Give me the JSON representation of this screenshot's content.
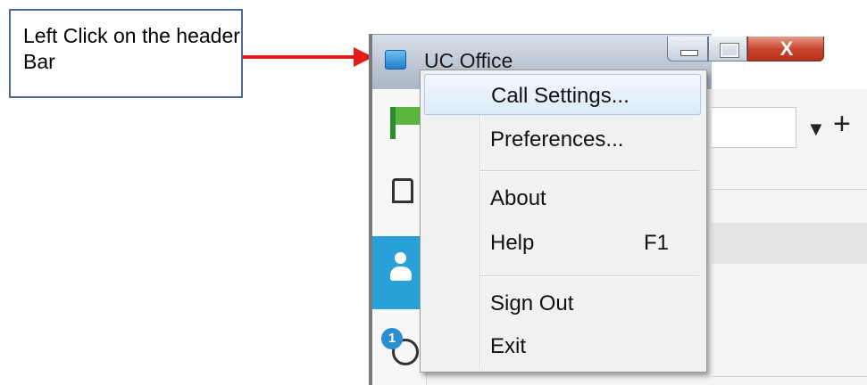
{
  "annotation": {
    "callout_text": "Left Click on the header Bar",
    "arrow_color": "#e21b1b",
    "border_color": "#4a6b96"
  },
  "window": {
    "title": "UC Office",
    "app_icon": "uc-office-app-icon",
    "caption_buttons": [
      "minimize",
      "maximize",
      "close"
    ],
    "close_glyph": "X"
  },
  "sidebar": {
    "items": [
      {
        "icon": "flag-icon"
      },
      {
        "icon": "building-icon"
      },
      {
        "icon": "person-icon",
        "selected": true
      },
      {
        "icon": "history-icon",
        "badge": "1"
      }
    ],
    "accent_color": "#2aa0d8"
  },
  "toolbar": {
    "filter_icon": "filter-icon",
    "add_glyph": "+"
  },
  "context_menu": {
    "items": [
      {
        "label": "Call Settings...",
        "shortcut": "",
        "highlighted": true
      },
      {
        "label": "Preferences...",
        "shortcut": ""
      },
      {
        "label": "About",
        "shortcut": ""
      },
      {
        "label": "Help",
        "shortcut": "F1"
      },
      {
        "label": "Sign Out",
        "shortcut": ""
      },
      {
        "label": "Exit",
        "shortcut": ""
      }
    ]
  }
}
